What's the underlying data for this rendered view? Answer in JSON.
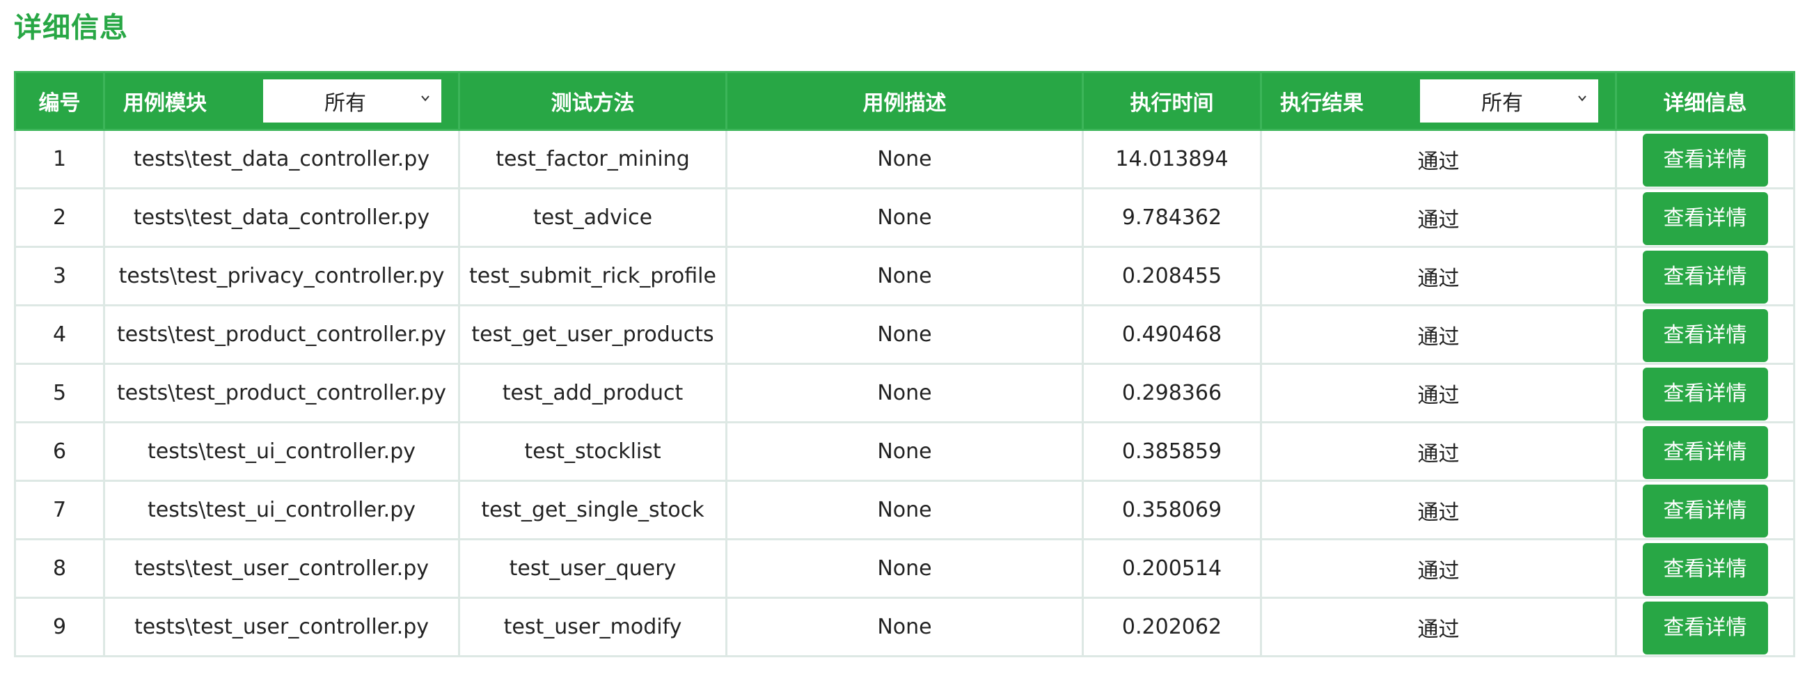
{
  "page": {
    "title": "详细信息"
  },
  "table": {
    "headers": {
      "index": "编号",
      "module": "用例模块",
      "method": "测试方法",
      "description": "用例描述",
      "time": "执行时间",
      "result": "执行结果",
      "detail": "详细信息"
    },
    "module_filter": {
      "selected": "所有"
    },
    "result_filter": {
      "selected": "所有"
    },
    "rows": [
      {
        "index": "1",
        "module": "tests\\test_data_controller.py",
        "method": "test_factor_mining",
        "description": "None",
        "time": "14.013894",
        "result": "通过",
        "action": "查看详情"
      },
      {
        "index": "2",
        "module": "tests\\test_data_controller.py",
        "method": "test_advice",
        "description": "None",
        "time": "9.784362",
        "result": "通过",
        "action": "查看详情"
      },
      {
        "index": "3",
        "module": "tests\\test_privacy_controller.py",
        "method": "test_submit_rick_profile",
        "description": "None",
        "time": "0.208455",
        "result": "通过",
        "action": "查看详情"
      },
      {
        "index": "4",
        "module": "tests\\test_product_controller.py",
        "method": "test_get_user_products",
        "description": "None",
        "time": "0.490468",
        "result": "通过",
        "action": "查看详情"
      },
      {
        "index": "5",
        "module": "tests\\test_product_controller.py",
        "method": "test_add_product",
        "description": "None",
        "time": "0.298366",
        "result": "通过",
        "action": "查看详情"
      },
      {
        "index": "6",
        "module": "tests\\test_ui_controller.py",
        "method": "test_stocklist",
        "description": "None",
        "time": "0.385859",
        "result": "通过",
        "action": "查看详情"
      },
      {
        "index": "7",
        "module": "tests\\test_ui_controller.py",
        "method": "test_get_single_stock",
        "description": "None",
        "time": "0.358069",
        "result": "通过",
        "action": "查看详情"
      },
      {
        "index": "8",
        "module": "tests\\test_user_controller.py",
        "method": "test_user_query",
        "description": "None",
        "time": "0.200514",
        "result": "通过",
        "action": "查看详情"
      },
      {
        "index": "9",
        "module": "tests\\test_user_controller.py",
        "method": "test_user_modify",
        "description": "None",
        "time": "0.202062",
        "result": "通过",
        "action": "查看详情"
      }
    ]
  },
  "colors": {
    "accent": "#28a745",
    "grid": "#dde8e4",
    "header_text": "#ffffff"
  },
  "icons": {
    "select_arrow": "chevron-down-icon"
  }
}
